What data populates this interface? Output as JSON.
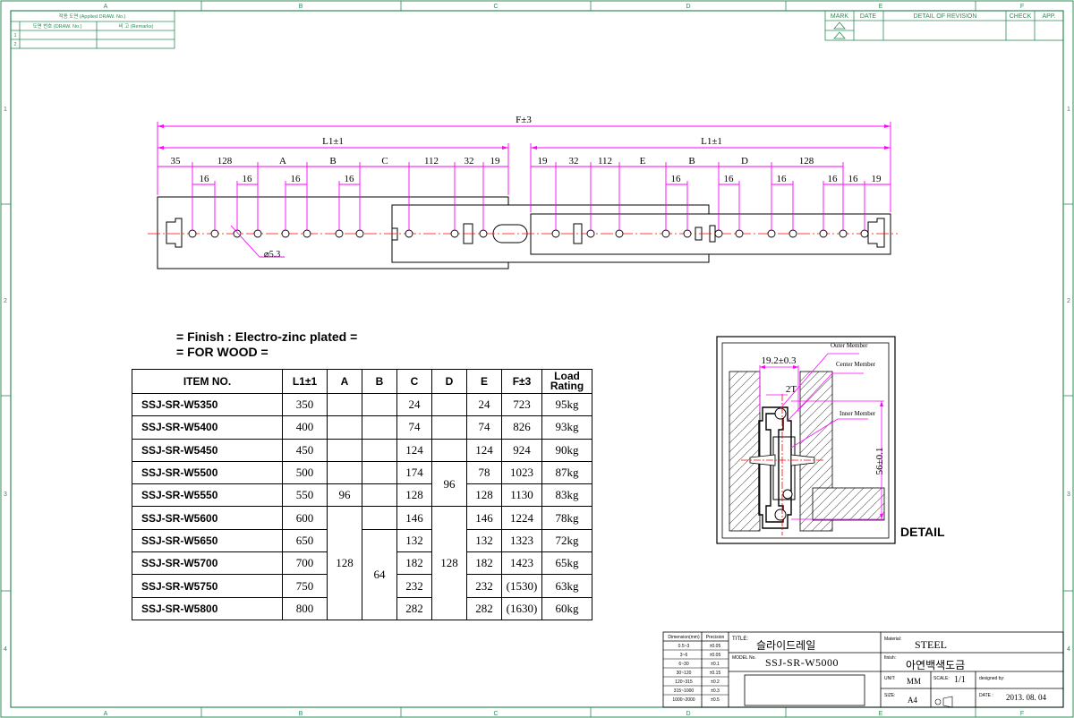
{
  "frame": {
    "col_labels": [
      "A",
      "B",
      "C",
      "D",
      "E",
      "F"
    ],
    "row_labels": [
      "1",
      "2",
      "3",
      "4"
    ]
  },
  "applied_drawing": {
    "title": "적용 도면 (Applied DRAW. No.)",
    "col1": "도면 번호 (DRAW. No.)",
    "col2": "비 고 (Remarks)",
    "rows": [
      "1",
      "2"
    ]
  },
  "revision": {
    "headers": [
      "MARK",
      "DATE",
      "DETAIL OF REVISION",
      "CHECK",
      "APP."
    ]
  },
  "dimensions": {
    "overall": "F±3",
    "left_len": "L1±1",
    "right_len": "L1±1",
    "left_segments": [
      "35",
      "128",
      "A",
      "B",
      "C",
      "112",
      "32",
      "19"
    ],
    "right_segments": [
      "19",
      "32",
      "112",
      "E",
      "B",
      "D",
      "128"
    ],
    "sixteens": [
      "16",
      "16",
      "16",
      "16",
      "16",
      "16",
      "16",
      "16",
      "16"
    ],
    "right_end": "19",
    "hole_dia": "⌀5.3"
  },
  "notes": {
    "finish": "= Finish : Electro-zinc plated =",
    "wood": "= FOR WOOD ="
  },
  "table": {
    "headers": [
      "ITEM NO.",
      "L1±1",
      "A",
      "B",
      "C",
      "D",
      "E",
      "F±3",
      "Load Rating"
    ],
    "rows": [
      {
        "item": "SSJ-SR-W5350",
        "l1": "350",
        "c": "24",
        "e": "24",
        "f": "723",
        "load": "95kg"
      },
      {
        "item": "SSJ-SR-W5400",
        "l1": "400",
        "c": "74",
        "e": "74",
        "f": "826",
        "load": "93kg"
      },
      {
        "item": "SSJ-SR-W5450",
        "l1": "450",
        "c": "124",
        "e": "124",
        "f": "924",
        "load": "90kg"
      },
      {
        "item": "SSJ-SR-W5500",
        "l1": "500",
        "c": "174",
        "e": "78",
        "f": "1023",
        "load": "87kg"
      },
      {
        "item": "SSJ-SR-W5550",
        "l1": "550",
        "c": "128",
        "e": "128",
        "f": "1130",
        "load": "83kg"
      },
      {
        "item": "SSJ-SR-W5600",
        "l1": "600",
        "c": "146",
        "e": "146",
        "f": "1224",
        "load": "78kg"
      },
      {
        "item": "SSJ-SR-W5650",
        "l1": "650",
        "c": "132",
        "e": "132",
        "f": "1323",
        "load": "72kg"
      },
      {
        "item": "SSJ-SR-W5700",
        "l1": "700",
        "c": "182",
        "e": "182",
        "f": "1423",
        "load": "65kg"
      },
      {
        "item": "SSJ-SR-W5750",
        "l1": "750",
        "c": "232",
        "e": "232",
        "f": "(1530)",
        "load": "63kg"
      },
      {
        "item": "SSJ-SR-W5800",
        "l1": "800",
        "c": "282",
        "e": "282",
        "f": "(1630)",
        "load": "60kg"
      }
    ],
    "merged": {
      "a_top": "96",
      "a_bottom": "128",
      "b_bottom": "64",
      "d_top": "96",
      "d_bottom": "128"
    }
  },
  "detail": {
    "outer_member": "Outer Member",
    "center_member": "Center Member",
    "inner_member": "Inner Member",
    "width": "19.2±0.3",
    "thickness": "2T",
    "height": "56±0.1",
    "label": "DETAIL"
  },
  "title_block": {
    "tolerance_header": [
      "Dimension(mm)",
      "Precision"
    ],
    "tolerances": [
      [
        "0.5~3",
        "±0.05"
      ],
      [
        "3~6",
        "±0.05"
      ],
      [
        "6~30",
        "±0.1"
      ],
      [
        "30~120",
        "±0.15"
      ],
      [
        "120~315",
        "±0.2"
      ],
      [
        "315~1000",
        "±0.3"
      ],
      [
        "1000~2000",
        "±0.5"
      ]
    ],
    "title_label": "TITLE:",
    "title": "슬라이드레일",
    "model_label": "MODEL No.",
    "model": "SSJ-SR-W5000",
    "material_label": "Material:",
    "material": "STEEL",
    "finish_label": "finish:",
    "finish": "아연백색도금",
    "unit_label": "UNIT:",
    "unit": "MM",
    "scale_label": "SCALE:",
    "scale": "1/1",
    "designed_label": "designed by:",
    "size_label": "SIZE:",
    "size": "A4",
    "date_label": "DATE :",
    "date": "2013. 08. 04"
  },
  "colors": {
    "frame": "#2e8b57",
    "dimension": "#ff00ff",
    "centerline": "#ff0000",
    "part": "#000000"
  }
}
